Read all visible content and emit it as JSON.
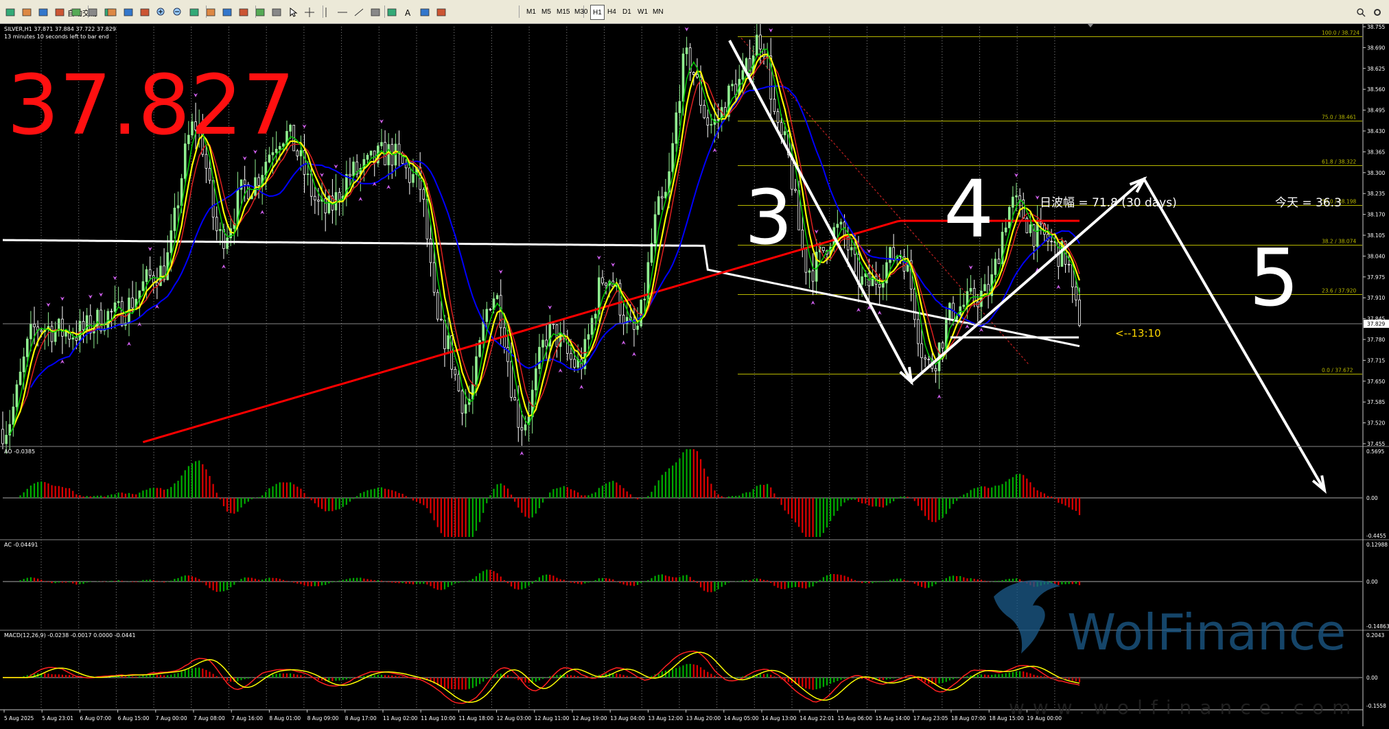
{
  "toolbar": {
    "autotrade_label": "自动交易",
    "timeframes": [
      "M1",
      "M5",
      "M15",
      "M30",
      "H1",
      "H4",
      "D1",
      "W1",
      "MN"
    ],
    "active_timeframe": "H1",
    "icons": [
      "new-chart-icon",
      "profiles-icon",
      "market-watch-icon",
      "data-window-icon",
      "navigator-icon",
      "terminal-icon",
      "autotrade-icon",
      "bar-chart-icon",
      "candle-chart-icon",
      "line-chart-icon",
      "zoom-in-icon",
      "zoom-out-icon",
      "tile-icon",
      "autoscroll-icon",
      "chart-shift-icon",
      "indicators-icon",
      "periods-icon",
      "templates-icon",
      "cursor-icon",
      "crosshair-icon",
      "vertical-line-icon",
      "horizontal-line-icon",
      "trendline-icon",
      "channel-icon",
      "fibonacci-icon",
      "text-icon",
      "label-icon",
      "arrows-icon",
      "search-icon",
      "settings-icon"
    ]
  },
  "chart": {
    "symbol_line": "SILVER,H1  37.871 37.884 37.722 37.829",
    "timer_line": "13 minutes 10 seconds left to bar end",
    "big_price": "37.827",
    "countdown": "<--13:10",
    "info_text_left": "日波幅 = 71.8 (30 days)",
    "info_text_right": "今天 = 36.3",
    "wave_labels": [
      "3",
      "4",
      "5"
    ],
    "watermark": "WolFinance",
    "watermark_url": "www.wolfinance.com",
    "price_axis_labels": [
      "38.755",
      "38.690",
      "38.625",
      "38.560",
      "38.495",
      "38.430",
      "38.365",
      "38.300",
      "38.235",
      "38.170",
      "38.105",
      "38.040",
      "37.975",
      "37.910",
      "37.845",
      "37.780",
      "37.715",
      "37.650",
      "37.585",
      "37.520",
      "37.455"
    ],
    "current_price_label": "37.829",
    "fib_levels": [
      {
        "pct": "100.0",
        "price": "38.724",
        "value": 38.724
      },
      {
        "pct": "75.0",
        "price": "38.461",
        "value": 38.461
      },
      {
        "pct": "61.8",
        "price": "38.322",
        "value": 38.322
      },
      {
        "pct": "50.0",
        "price": "38.198",
        "value": 38.198
      },
      {
        "pct": "38.2",
        "price": "38.074",
        "value": 38.074
      },
      {
        "pct": "23.6",
        "price": "37.920",
        "value": 37.92
      },
      {
        "pct": "0.0",
        "price": "37.672",
        "value": 37.672
      }
    ],
    "time_labels": [
      "5 Aug 2025",
      "5 Aug 23:01",
      "6 Aug 07:00",
      "6 Aug 15:00",
      "7 Aug 00:00",
      "7 Aug 08:00",
      "7 Aug 16:00",
      "8 Aug 01:00",
      "8 Aug 09:00",
      "8 Aug 17:00",
      "11 Aug 02:00",
      "11 Aug 10:00",
      "11 Aug 18:00",
      "12 Aug 03:00",
      "12 Aug 11:00",
      "12 Aug 19:00",
      "13 Aug 04:00",
      "13 Aug 12:00",
      "13 Aug 20:00",
      "14 Aug 05:00",
      "14 Aug 13:00",
      "14 Aug 22:01",
      "15 Aug 06:00",
      "15 Aug 14:00",
      "17 Aug 23:05",
      "18 Aug 07:00",
      "18 Aug 15:00",
      "19 Aug 00:00"
    ]
  },
  "indicators": {
    "ao": {
      "label": "AO -0.0385",
      "max": "0.5695",
      "zero": "0.00",
      "min": "-0.4455"
    },
    "ac": {
      "label": "AC -0.04491",
      "max": "0.12988",
      "zero": "0.00",
      "min": "-0.14863"
    },
    "macd": {
      "label": "MACD(12,26,9) -0.0238 -0.0017 0.0000 -0.0441",
      "max": "0.2043",
      "zero": "0.00",
      "min": "-0.1558"
    }
  },
  "colors": {
    "bull": "#90ee90",
    "bear": "#ffffff",
    "ma_red": "#ff0000",
    "ma_white": "#ffffff",
    "ma_yellow": "#ffff00",
    "ma_green": "#00cc00",
    "ma_blue": "#0000ff",
    "fib": "#b8b800",
    "macd_signal": "#ffff00",
    "macd_line": "#ff2020",
    "hist_green": "#00aa00",
    "hist_red": "#dd0000"
  }
}
